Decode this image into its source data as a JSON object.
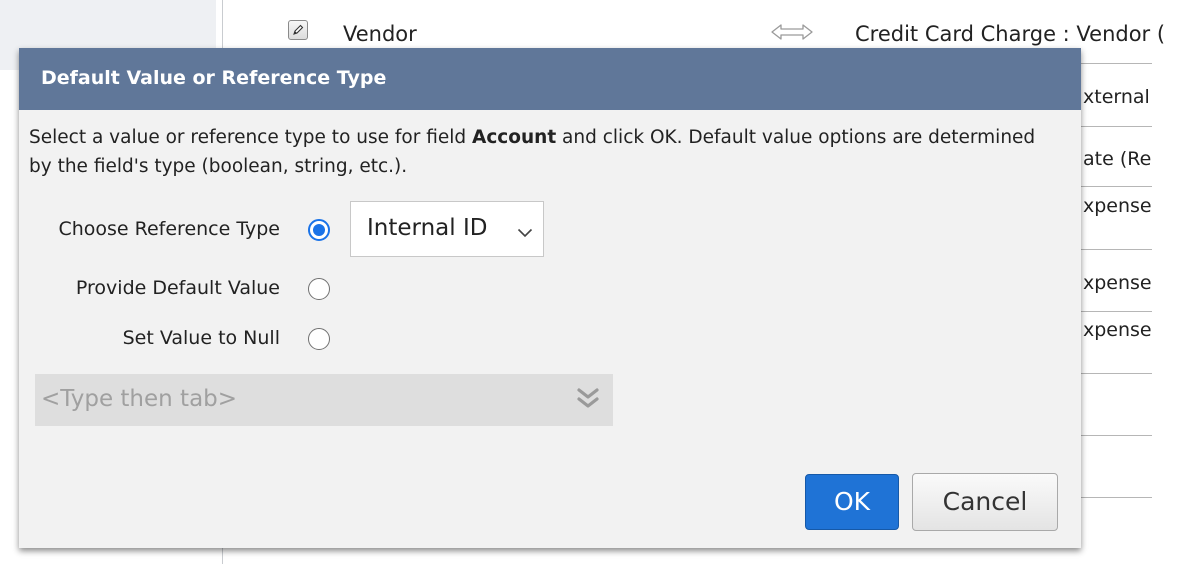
{
  "background": {
    "row_label": "Vendor",
    "row_mapping": "Credit Card Charge : Vendor (",
    "right_column_fragments": [
      "xternal",
      "ate (Re",
      "xpense",
      "xpense",
      "xpense"
    ]
  },
  "dialog": {
    "title": "Default Value or Reference Type",
    "instructions_pre": "Select a value or reference type to use for field ",
    "instructions_field": "Account",
    "instructions_post": " and click OK. Default value options are determined by the field's type (boolean, string, etc.).",
    "options": [
      {
        "label": "Choose Reference Type",
        "selected": true
      },
      {
        "label": "Provide Default Value",
        "selected": false
      },
      {
        "label": "Set Value to Null",
        "selected": false
      }
    ],
    "reference_type_select": {
      "value": "Internal ID"
    },
    "type_field": {
      "placeholder": "<Type then tab>"
    },
    "ok_label": "OK",
    "cancel_label": "Cancel"
  },
  "colors": {
    "header": "#607799",
    "accent": "#1a73e8",
    "ok_button": "#1f73d6"
  },
  "icons": {
    "edit": "pencil-edit-icon",
    "mapping": "bidirectional-arrow-icon",
    "select": "chevron-down-icon",
    "type_field": "double-chevron-down-icon"
  }
}
